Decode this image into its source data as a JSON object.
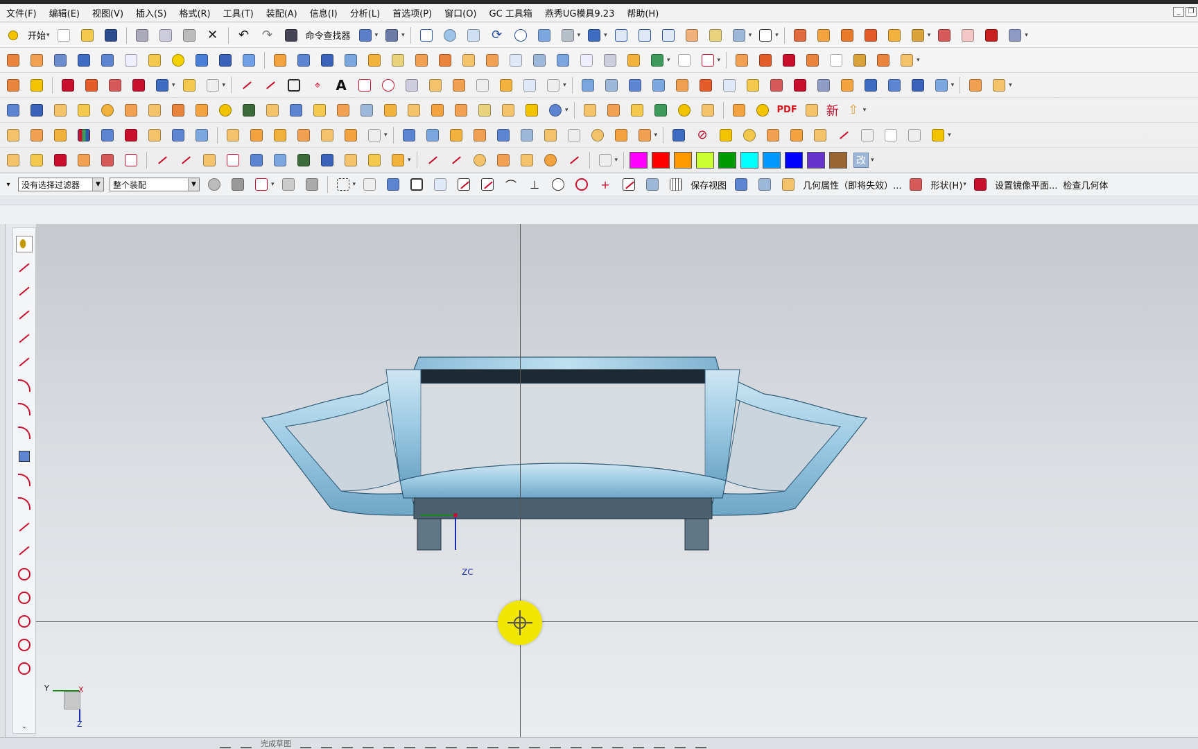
{
  "menubar": {
    "items": [
      "文件(F)",
      "编辑(E)",
      "视图(V)",
      "插入(S)",
      "格式(R)",
      "工具(T)",
      "装配(A)",
      "信息(I)",
      "分析(L)",
      "首选项(P)",
      "窗口(O)",
      "GC 工具箱",
      "燕秀UG模具9.23",
      "帮助(H)"
    ]
  },
  "window_controls": {
    "minimize_label": "_",
    "restore_label": "❐"
  },
  "toolbar": {
    "start_label": "开始",
    "command_finder_label": "命令查找器",
    "pdf_label": "PDF",
    "new_label": "新"
  },
  "selection_bar": {
    "filter_value": "没有选择过滤器",
    "scope_value": "整个装配",
    "save_view_label": "保存视图",
    "geometry_props_label": "几何属性（即将失效）...",
    "shape_label": "形状(H)",
    "mirror_plane_label": "设置镜像平面...",
    "check_geometry_label": "检查几何体"
  },
  "color_swatches": [
    "#ff00ff",
    "#ff0000",
    "#ff9900",
    "#ccff33",
    "#009900",
    "#00ffff",
    "#0099ff",
    "#0000ff",
    "#6633cc",
    "#996633"
  ],
  "swatch_extra_label": "改",
  "viewport": {
    "zc_label": "ZC",
    "triad_y_label": "Y",
    "triad_z_label": "Z",
    "triad_x_label": "X"
  },
  "bottom_bar": {
    "finish_sketch_label": "完成草图"
  },
  "left_toolbar_more": "⌄"
}
